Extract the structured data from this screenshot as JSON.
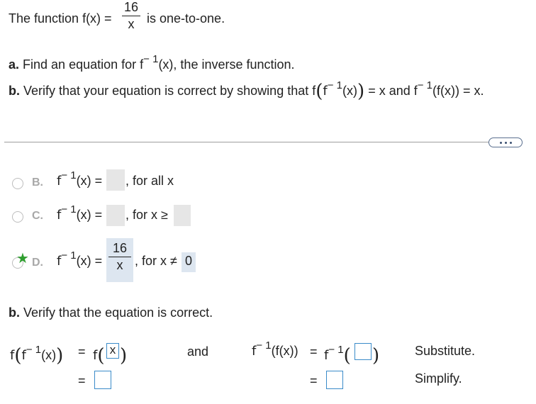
{
  "intro": {
    "prefix": "The function f(x) =",
    "numerator": "16",
    "denominator": "x",
    "suffix": "is one-to-one."
  },
  "part_a": {
    "label": "a.",
    "text_before": "Find an equation for f",
    "superscript": "− 1",
    "text_after": "(x), the inverse function."
  },
  "part_b_intro": {
    "label": "b.",
    "text1": "Verify that your equation is correct by showing that f",
    "text2": "f",
    "sup1": "− 1",
    "text3": "(x)",
    "text4": "= x and f",
    "sup2": "− 1",
    "text5": "(f(x)) = x."
  },
  "options": {
    "B": {
      "letter": "B.",
      "func": "f",
      "sup": "− 1",
      "arg": "(x) =",
      "condition": ", for all x"
    },
    "C": {
      "letter": "C.",
      "func": "f",
      "sup": "− 1",
      "arg": "(x) =",
      "condition": ", for x ≥"
    },
    "D": {
      "letter": "D.",
      "func": "f",
      "sup": "− 1",
      "arg": "(x) =",
      "numerator": "16",
      "denominator": "x",
      "condition": ", for x ≠",
      "condition_value": "0"
    }
  },
  "verify": {
    "heading_label": "b.",
    "heading_text": "Verify that the equation is correct.",
    "left_f": "f",
    "left_inner_f": "f",
    "left_sup": "− 1",
    "left_arg": "(x)",
    "equals": "=",
    "left_rhs_f": "f",
    "left_input_value": "x",
    "and_label": "and",
    "right_f": "f",
    "right_sup": "− 1",
    "right_arg": "(f(x))",
    "right_rhs_f": "f",
    "right_rhs_sup": "− 1",
    "substitute_label": "Substitute.",
    "simplify_label": "Simplify."
  }
}
